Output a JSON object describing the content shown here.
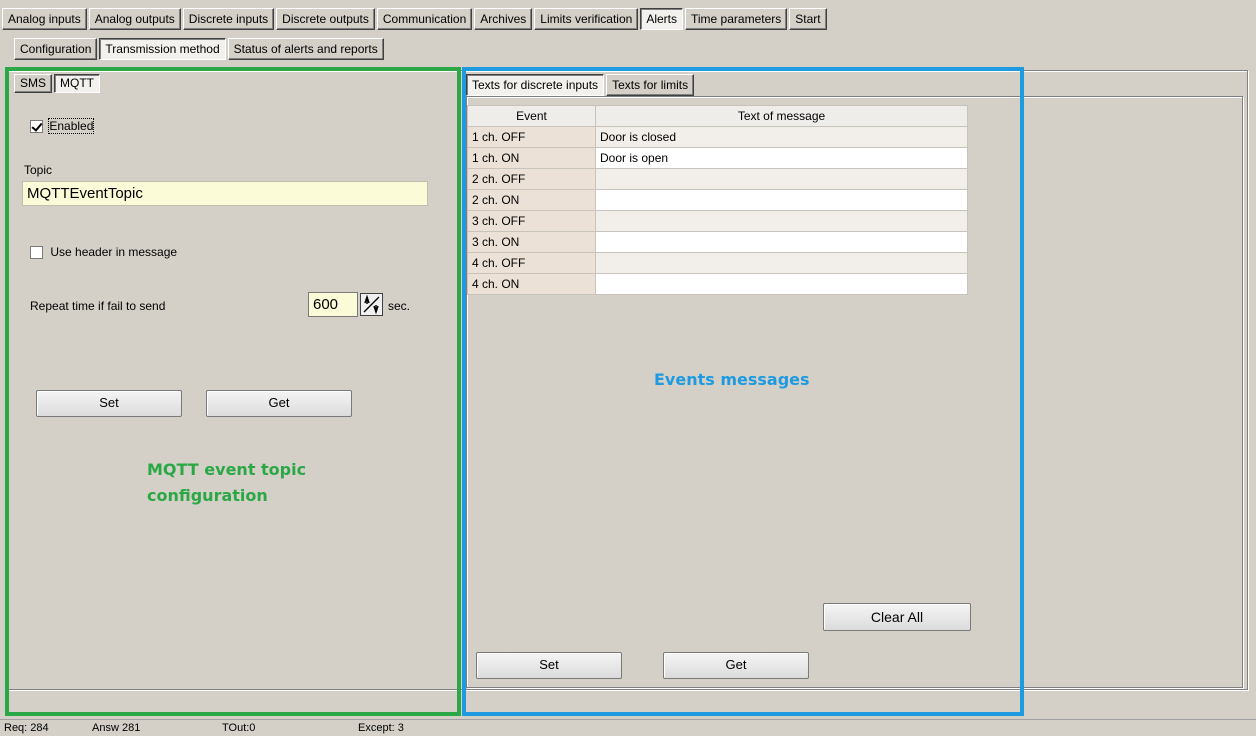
{
  "top_tabs": [
    "Analog inputs",
    "Analog outputs",
    "Discrete inputs",
    "Discrete outputs",
    "Communication",
    "Archives",
    "Limits verification",
    "Alerts",
    "Time parameters",
    "Start"
  ],
  "sub_tabs": [
    "Configuration",
    "Transmission method",
    "Status of alerts and reports"
  ],
  "method_tabs": [
    "SMS",
    "MQTT"
  ],
  "mqtt": {
    "enabled_label": "Enabled",
    "enabled": true,
    "topic_label": "Topic",
    "topic_value": "MQTTEventTopic",
    "use_header_label": "Use header in message",
    "use_header": false,
    "repeat_label": "Repeat time if fail to send",
    "repeat_value": "600",
    "repeat_unit": "sec.",
    "set_label": "Set",
    "get_label": "Get"
  },
  "annotations": {
    "left_line1": "MQTT event topic",
    "left_line2": "configuration",
    "right": "Events messages",
    "left_color": "#2aa845",
    "right_color": "#1e9be0"
  },
  "texts_tabs": [
    "Texts for discrete inputs",
    "Texts for limits"
  ],
  "events_table": {
    "headers": [
      "Event",
      "Text of message"
    ],
    "rows": [
      {
        "event": "1 ch. OFF",
        "text": "Door is closed"
      },
      {
        "event": "1 ch. ON",
        "text": "Door is open"
      },
      {
        "event": "2 ch. OFF",
        "text": ""
      },
      {
        "event": "2 ch. ON",
        "text": ""
      },
      {
        "event": "3 ch. OFF",
        "text": ""
      },
      {
        "event": "3 ch. ON",
        "text": ""
      },
      {
        "event": "4 ch. OFF",
        "text": ""
      },
      {
        "event": "4 ch. ON",
        "text": ""
      }
    ]
  },
  "events_buttons": {
    "clear_all": "Clear All",
    "set": "Set",
    "get": "Get"
  },
  "status_bar": {
    "req": "Req: 284",
    "answ": "Answ   281",
    "tout": "TOut:0",
    "except": "Except:  3"
  }
}
